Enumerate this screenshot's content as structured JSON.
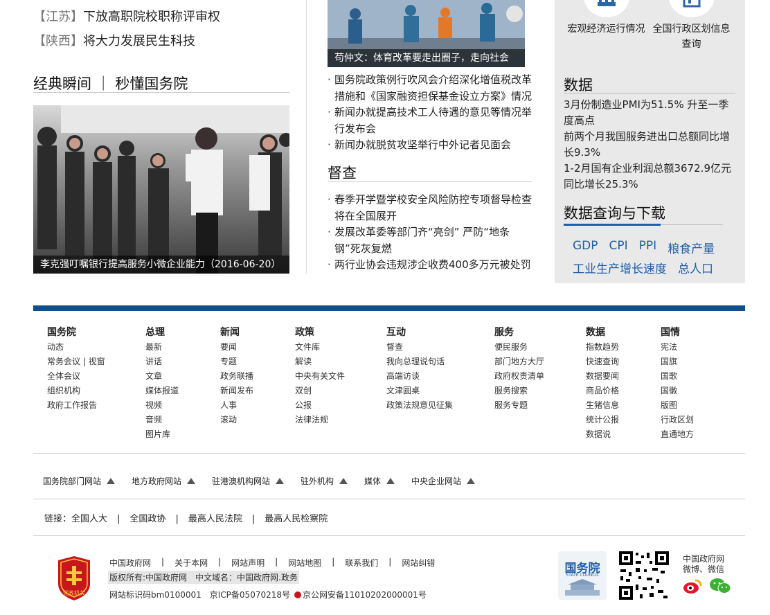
{
  "provinces": [
    {
      "tag": "【江苏】",
      "text": "下放高职院校职称评审权"
    },
    {
      "tag": "【陕西】",
      "text": "将大力发展民生科技"
    }
  ],
  "classic": {
    "title": "经典瞬间 ｜ 秒懂国务院",
    "caption": "李克强叮嘱银行提高服务小微企业能力（2016-06-20）"
  },
  "middle": {
    "top_caption": "苟仲文：体育改革要走出圈子，走向社会",
    "news": [
      "国务院政策例行吹风会介绍深化增值税改革措施和《国家融资担保基金设立方案》情况",
      "新闻办就提高技术工人待遇的意见等情况举行发布会",
      "新闻办就脱贫攻坚举行中外记者见面会"
    ],
    "supervise_title": "督查",
    "supervise_news": [
      "春季开学暨学校安全风险防控专项督导检查将在全国展开",
      "发展改革委等部门齐“亮剑” 严防“地条钢”死灰复燃",
      "两行业协会违规涉企收费400多万元被处罚"
    ]
  },
  "right": {
    "icons": [
      {
        "label": "宏观经济运行情况",
        "icon": "chart-icon"
      },
      {
        "label": "全国行政区划信息查询",
        "icon": "map-icon"
      }
    ],
    "data_title": "数据",
    "data_items": [
      "3月份制造业PMI为51.5% 升至一季度高点",
      "前两个月我国服务进出口总额同比增长9.3%",
      "1-2月国有企业利润总额3672.9亿元同比增长25.3%"
    ],
    "query_title": "数据查询与下载",
    "query_links_row1": [
      "GDP",
      "CPI",
      "PPI",
      "粮食产量"
    ],
    "query_links_row2": [
      "工业生产增长速度",
      "总人口"
    ]
  },
  "footer": {
    "columns": [
      {
        "title": "国务院",
        "items": [
          "动态",
          "常务会议 | 视窗",
          "全体会议",
          "组织机构",
          "政府工作报告"
        ]
      },
      {
        "title": "总理",
        "items": [
          "最新",
          "讲话",
          "文章",
          "媒体报道",
          "视频",
          "音频",
          "图片库"
        ]
      },
      {
        "title": "新闻",
        "items": [
          "要闻",
          "专题",
          "政务联播",
          "新闻发布",
          "人事",
          "滚动"
        ]
      },
      {
        "title": "政策",
        "items": [
          "文件库",
          "解读",
          "中央有关文件",
          "双创",
          "公报",
          "法律法规"
        ]
      },
      {
        "title": "互动",
        "items": [
          "督查",
          "我向总理说句话",
          "高端访谈",
          "文津圆桌",
          "政策法规意见征集"
        ]
      },
      {
        "title": "服务",
        "items": [
          "便民服务",
          "部门地方大厅",
          "政府权责清单",
          "服务搜索",
          "服务专题"
        ]
      },
      {
        "title": "数据",
        "items": [
          "指数趋势",
          "快速查询",
          "数据要闻",
          "商品价格",
          "生猪信息",
          "统计公报",
          "数据说"
        ]
      },
      {
        "title": "国情",
        "items": [
          "宪法",
          "国旗",
          "国歌",
          "国徽",
          "版图",
          "行政区划",
          "直通地方"
        ]
      }
    ],
    "site_links": [
      "国务院部门网站",
      "地方政府网站",
      "驻港澳机构网站",
      "驻外机构",
      "媒体",
      "中央企业网站"
    ],
    "links_label": "链接：",
    "links": [
      "全国人大",
      "全国政协",
      "最高人民法院",
      "最高人民检察院"
    ],
    "bottom_nav": [
      "中国政府网",
      "关于本网",
      "网站声明",
      "网站地图",
      "联系我们",
      "网站纠错"
    ],
    "copyright": "版权所有:中国政府网　中文域名：中国政府网.政务",
    "site_id": "网站标识码bm0100001",
    "icp": "京ICP备05070218号",
    "police": "京公网安备11010202000001号",
    "badge_text": "党政机关",
    "logo_text": "国务院",
    "logo_sub": "STATE COUNCIL",
    "wechat_title": "中国政府网",
    "wechat_sub": "微博、微信"
  }
}
